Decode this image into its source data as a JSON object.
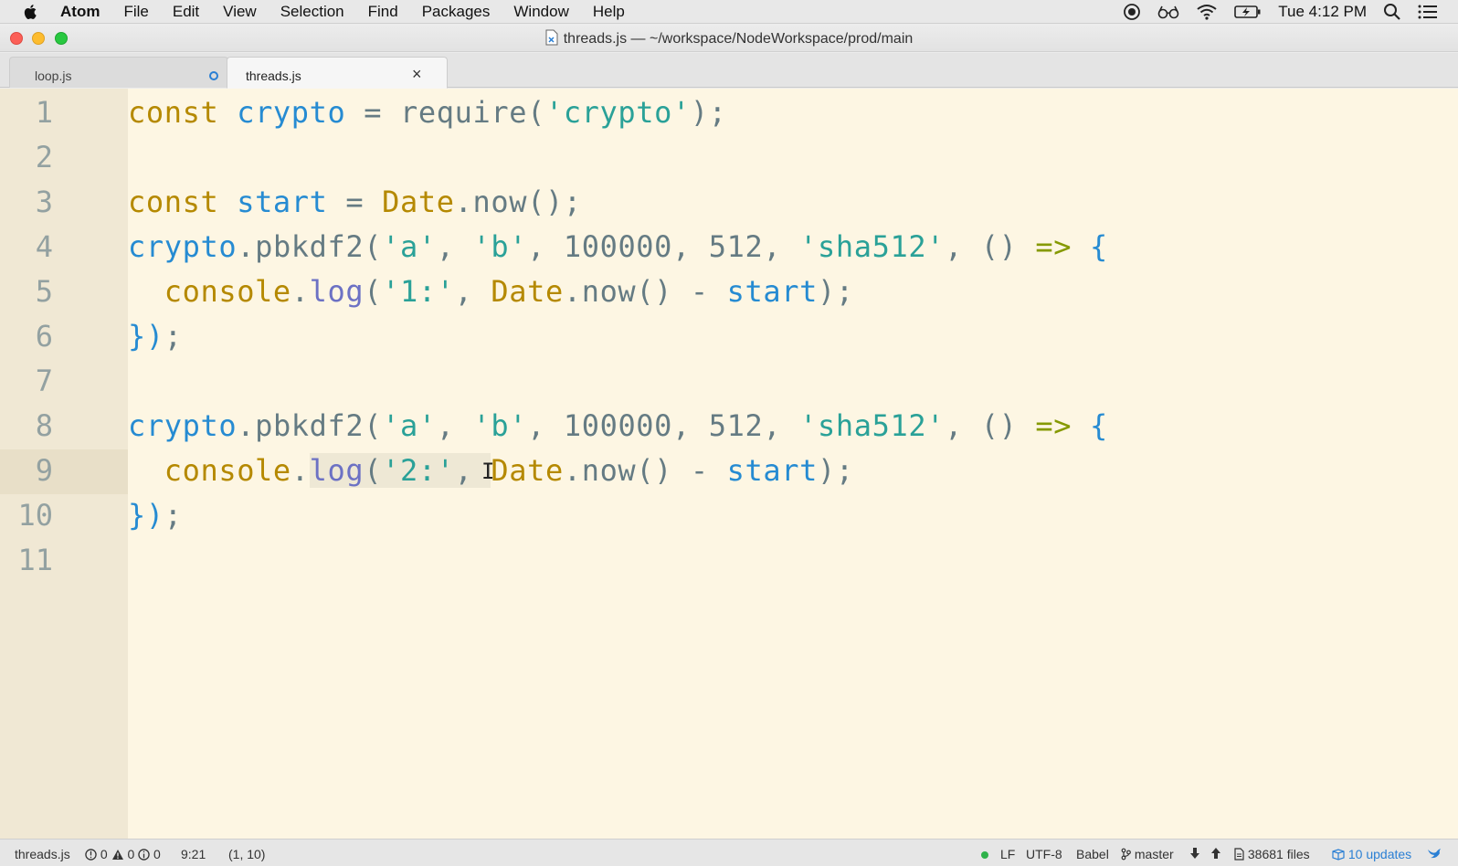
{
  "menubar": {
    "items": [
      "Atom",
      "File",
      "Edit",
      "View",
      "Selection",
      "Find",
      "Packages",
      "Window",
      "Help"
    ],
    "clock": "Tue 4:12 PM",
    "icons": [
      "apple-icon",
      "record-icon",
      "glasses-icon",
      "wifi-icon",
      "battery-icon",
      "search-icon",
      "list-icon"
    ]
  },
  "window": {
    "title": "threads.js — ~/workspace/NodeWorkspace/prod/main"
  },
  "tabs": [
    {
      "label": "loop.js",
      "modified": true
    },
    {
      "label": "threads.js",
      "active": true,
      "close": "×"
    }
  ],
  "editor": {
    "line_numbers": [
      "1",
      "2",
      "3",
      "4",
      "5",
      "6",
      "7",
      "8",
      "9",
      "10",
      "11"
    ],
    "cursor_line": "9",
    "lines": [
      "const crypto = require('crypto');",
      "",
      "const start = Date.now();",
      "crypto.pbkdf2('a', 'b', 100000, 512, 'sha512', () => {",
      "  console.log('1:', Date.now() - start);",
      "});",
      "",
      "crypto.pbkdf2('a', 'b', 100000, 512, 'sha512', () => {",
      "  console.log('2:', Date.now() - start);",
      "});",
      ""
    ],
    "tokens": {
      "l1": [
        "const",
        " ",
        "crypto",
        " = ",
        "require",
        "(",
        "'crypto'",
        ");"
      ],
      "l3": [
        "const",
        " ",
        "start",
        " = ",
        "Date",
        ".",
        "now",
        "();"
      ],
      "l4": [
        "crypto",
        ".",
        "pbkdf2",
        "(",
        "'a'",
        ", ",
        "'b'",
        ", ",
        "100000",
        ", ",
        "512",
        ", ",
        "'sha512'",
        ", ",
        "()",
        " ",
        "=>",
        " ",
        "{"
      ],
      "l5": [
        "  ",
        "console",
        ".",
        "log",
        "(",
        "'1:'",
        ", ",
        "Date",
        ".",
        "now",
        "()",
        " ",
        "-",
        " ",
        "start",
        ");"
      ],
      "l6": [
        "})",
        ";"
      ],
      "l8": [
        "crypto",
        ".",
        "pbkdf2",
        "(",
        "'a'",
        ", ",
        "'b'",
        ", ",
        "100000",
        ", ",
        "512",
        ", ",
        "'sha512'",
        ", ",
        "()",
        " ",
        "=>",
        " ",
        "{"
      ],
      "l9": [
        "  ",
        "console",
        ".",
        "log",
        "(",
        "'2:'",
        ", ",
        "Date",
        ".",
        "now",
        "()",
        " ",
        "-",
        " ",
        "start",
        ");"
      ],
      "l10": [
        "})",
        ";"
      ]
    }
  },
  "status": {
    "file": "threads.js",
    "errors": "0",
    "warnings": "0",
    "infos": "0",
    "cursor_pos": "9:21",
    "selection": "(1, 10)",
    "line_ending": "LF",
    "encoding": "UTF-8",
    "grammar": "Babel",
    "branch": "master",
    "files": "38681 files",
    "updates": "10 updates"
  }
}
